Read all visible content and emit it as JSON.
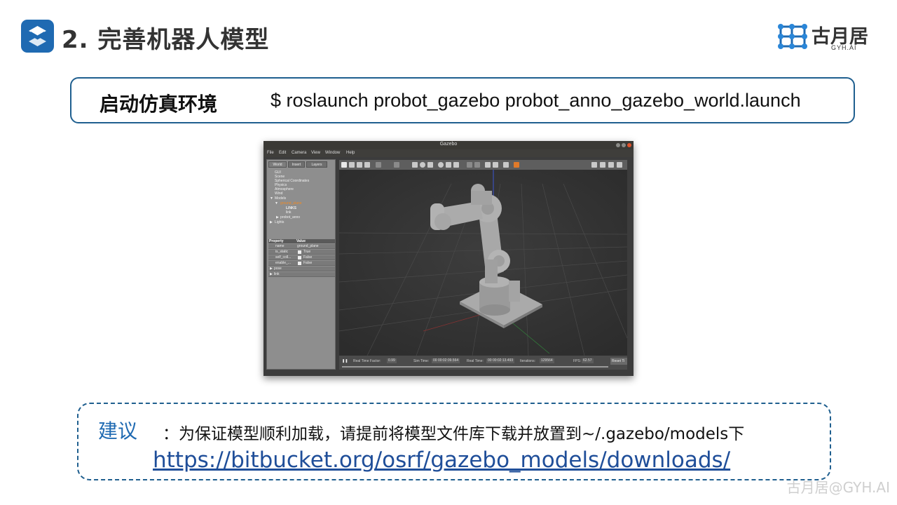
{
  "header": {
    "title": "2. 完善机器人模型",
    "brand_name": "古月居",
    "brand_sub": "GYH.AI",
    "accent": "#1f6ab2"
  },
  "command": {
    "label": "启动仿真环境",
    "text": "$ roslaunch probot_gazebo probot_anno_gazebo_world.launch"
  },
  "gazebo": {
    "window_title": "Gazebo",
    "menu": [
      "File",
      "Edit",
      "Camera",
      "View",
      "Window",
      "Help"
    ],
    "tabs": [
      "World",
      "Insert",
      "Layers"
    ],
    "tree": [
      {
        "label": "GUI",
        "level": 0
      },
      {
        "label": "Scene",
        "level": 0
      },
      {
        "label": "Spherical Coordinates",
        "level": 0
      },
      {
        "label": "Physics",
        "level": 0
      },
      {
        "label": "Atmosphere",
        "level": 0
      },
      {
        "label": "Wind",
        "level": 0
      },
      {
        "label": "Models",
        "level": 0,
        "expander": "▼"
      },
      {
        "label": "ground_plane",
        "level": 1,
        "expander": "▼",
        "selected": true
      },
      {
        "label": "LINKS",
        "level": 2,
        "bold": true
      },
      {
        "label": "link",
        "level": 2
      },
      {
        "label": "probot_anno",
        "level": 1,
        "expander": "▶"
      },
      {
        "label": "Lights",
        "level": 0,
        "expander": "▶"
      }
    ],
    "property_headers": [
      "Property",
      "Value"
    ],
    "properties": [
      {
        "key": "name",
        "value": "ground_plane",
        "checkbox": false
      },
      {
        "key": "is_static",
        "value": "True",
        "checkbox": true
      },
      {
        "key": "self_coll...",
        "value": "False",
        "checkbox": true
      },
      {
        "key": "enable_...",
        "value": "False",
        "checkbox": true
      }
    ],
    "groups": [
      {
        "label": "pose",
        "expander": "▶"
      },
      {
        "label": "link",
        "expander": "▶"
      }
    ],
    "status": {
      "pause": "❚❚",
      "rtf_label": "Real Time Factor:",
      "rtf_value": "0.99",
      "sim_label": "Sim Time:",
      "sim_value": "00 00:02:09.564",
      "real_label": "Real Time:",
      "real_value": "00 00:02:13.493",
      "iter_label": "Iterations:",
      "iter_value": "129564",
      "fps_label": "FPS:",
      "fps_value": "62.57",
      "reset": "Reset Ti"
    }
  },
  "tip": {
    "label": "建议",
    "text": "：为保证模型顺利加载，请提前将模型文件库下载并放置到~/.gazebo/models下",
    "link": "https://bitbucket.org/osrf/gazebo_models/downloads/"
  },
  "watermark": "古月居@GYH.AI"
}
